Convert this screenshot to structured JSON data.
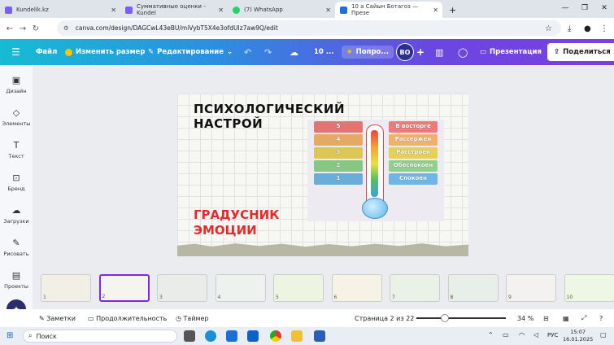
{
  "browser": {
    "tabs": [
      {
        "label": "Kundelik.kz",
        "active": false
      },
      {
        "label": "Суммативные оценки - Kundel",
        "active": false
      },
      {
        "label": "(7) WhatsApp",
        "active": false
      },
      {
        "label": "10 а Сайын Ботагоз — Презе",
        "active": true
      }
    ],
    "url": "canva.com/design/DAGCwL43eBU/miVybT5X4e3ofdUIz7aw9Q/edit"
  },
  "toolbar": {
    "file": "Файл",
    "resize": "Изменить размер",
    "editing": "Редактирование",
    "ten": "10 ...",
    "promo": "Попро...",
    "avatar": "ВО",
    "present": "Презентация",
    "share": "Поделиться"
  },
  "sidebar": {
    "items": [
      {
        "label": "Дизайн",
        "icon": "layout-icon"
      },
      {
        "label": "Элементы",
        "icon": "shapes-icon"
      },
      {
        "label": "Текст",
        "icon": "text-icon"
      },
      {
        "label": "Бренд",
        "icon": "brand-icon"
      },
      {
        "label": "Загрузки",
        "icon": "upload-icon"
      },
      {
        "label": "Рисовать",
        "icon": "pen-icon"
      },
      {
        "label": "Проекты",
        "icon": "folder-icon"
      }
    ]
  },
  "slide": {
    "title": "ПСИХОЛОГИЧЕСКИЙ НАСТРОЙ",
    "subtitle": "ГРАДУСНИК ЭМОЦИИ",
    "scale": [
      {
        "num": "5",
        "label": "В восторге",
        "color": "#f07a7a"
      },
      {
        "num": "4",
        "label": "Рассержен",
        "color": "#f2b16a"
      },
      {
        "num": "3",
        "label": "Расстроен",
        "color": "#e6d05a"
      },
      {
        "num": "2",
        "label": "Обеспокоен",
        "color": "#8fd08a"
      },
      {
        "num": "1",
        "label": "Спокоен",
        "color": "#6fb6e6"
      }
    ]
  },
  "thumbnails": [
    "1",
    "2",
    "3",
    "4",
    "5",
    "6",
    "7",
    "8",
    "9",
    "10"
  ],
  "bottom": {
    "notes": "Заметки",
    "duration": "Продолжительность",
    "timer": "Таймер",
    "page": "Страница 2 из 22",
    "zoom": "34 %"
  },
  "taskbar": {
    "search": "Поиск",
    "lang": "РУС",
    "time": "15:07",
    "date": "16.01.2025"
  }
}
